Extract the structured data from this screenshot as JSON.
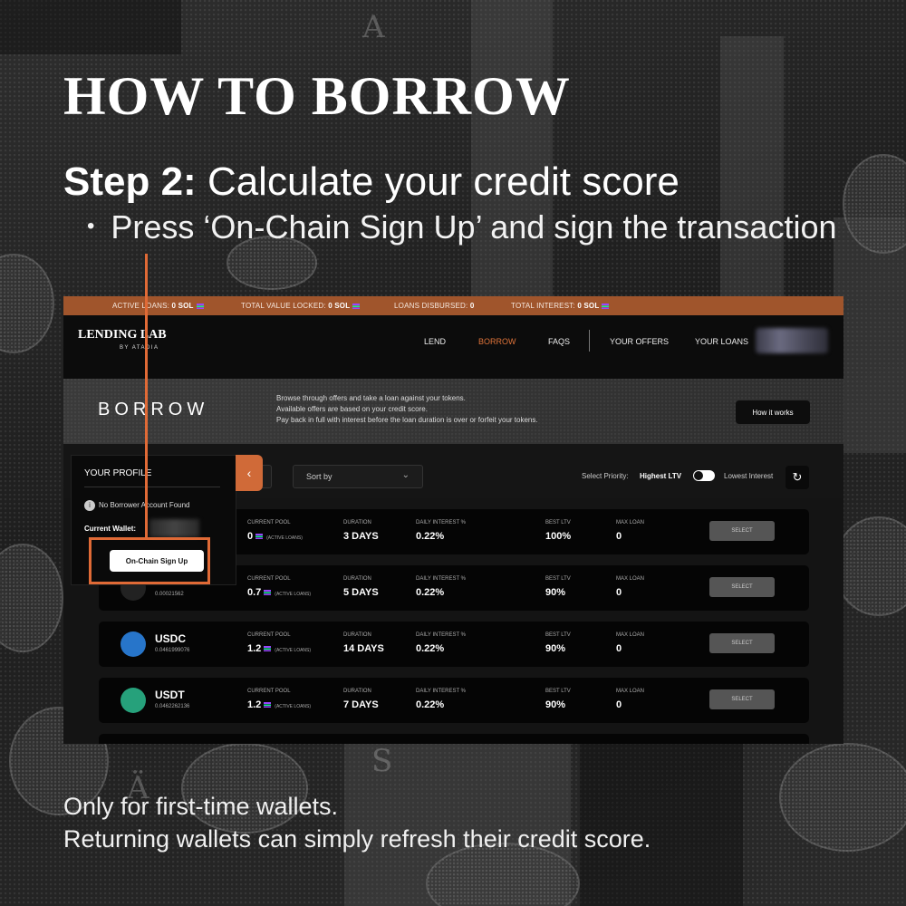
{
  "heading": {
    "title": "HOW TO BORROW",
    "step_label": "Step 2:",
    "step_text": "Calculate your credit score",
    "bullet": "Press ‘On-Chain Sign Up’ and sign the transaction"
  },
  "footer": {
    "line1": "Only for first-time wallets.",
    "line2": "Returning wallets can simply refresh their credit score."
  },
  "app": {
    "ticker": {
      "active_loans_label": "ACTIVE LOANS:",
      "active_loans_value": "0 SOL",
      "tvl_label": "TOTAL VALUE LOCKED:",
      "tvl_value": "0 SOL",
      "disbursed_label": "LOANS DISBURSED:",
      "disbursed_value": "0",
      "interest_label": "TOTAL INTEREST:",
      "interest_value": "0 SOL"
    },
    "nav": {
      "logo": "LENDING LAB",
      "logo_sub": "BY ATADIA",
      "lend": "LEND",
      "borrow": "BORROW",
      "faqs": "FAQS",
      "your_offers": "YOUR OFFERS",
      "your_loans": "YOUR LOANS"
    },
    "hero": {
      "title": "BORROW",
      "desc1": "Browse through offers and take a loan against your tokens.",
      "desc2": "Available offers are based on your credit score.",
      "desc3": "Pay back in full with interest before the loan duration is over or forfeit your tokens.",
      "how_it_works": "How it works"
    },
    "controls": {
      "sort_by": "Sort by",
      "select_priority": "Select Priority:",
      "highest_ltv": "Highest LTV",
      "lowest_interest": "Lowest Interest"
    },
    "profile": {
      "title": "YOUR PROFILE",
      "no_account": "No Borrower Account Found",
      "current_wallet": "Current Wallet:",
      "signup": "On-Chain Sign Up"
    },
    "columns": {
      "pool": "CURRENT POOL",
      "duration": "DURATION",
      "interest": "DAILY INTEREST %",
      "ltv": "BEST LTV",
      "max_loan": "MAX LOAN",
      "active_loans": "(ACTIVE LOANS)",
      "select": "SELECT"
    },
    "rows": [
      {
        "name": "",
        "price": "",
        "pool": "0",
        "duration": "3 DAYS",
        "interest": "0.22%",
        "ltv": "100%",
        "max_loan": "0",
        "icon_color": "#333333"
      },
      {
        "name": "",
        "price": "0.00021562",
        "pool": "0.7",
        "duration": "5 DAYS",
        "interest": "0.22%",
        "ltv": "90%",
        "max_loan": "0",
        "icon_color": "#222222"
      },
      {
        "name": "USDC",
        "price": "0.0461999076",
        "pool": "1.2",
        "duration": "14 DAYS",
        "interest": "0.22%",
        "ltv": "90%",
        "max_loan": "0",
        "icon_color": "#2775ca"
      },
      {
        "name": "USDT",
        "price": "0.0462262136",
        "pool": "1.2",
        "duration": "7 DAYS",
        "interest": "0.22%",
        "ltv": "90%",
        "max_loan": "0",
        "icon_color": "#26a17b"
      }
    ]
  },
  "colors": {
    "accent": "#e06a36",
    "ticker_bg": "#a0552c"
  }
}
